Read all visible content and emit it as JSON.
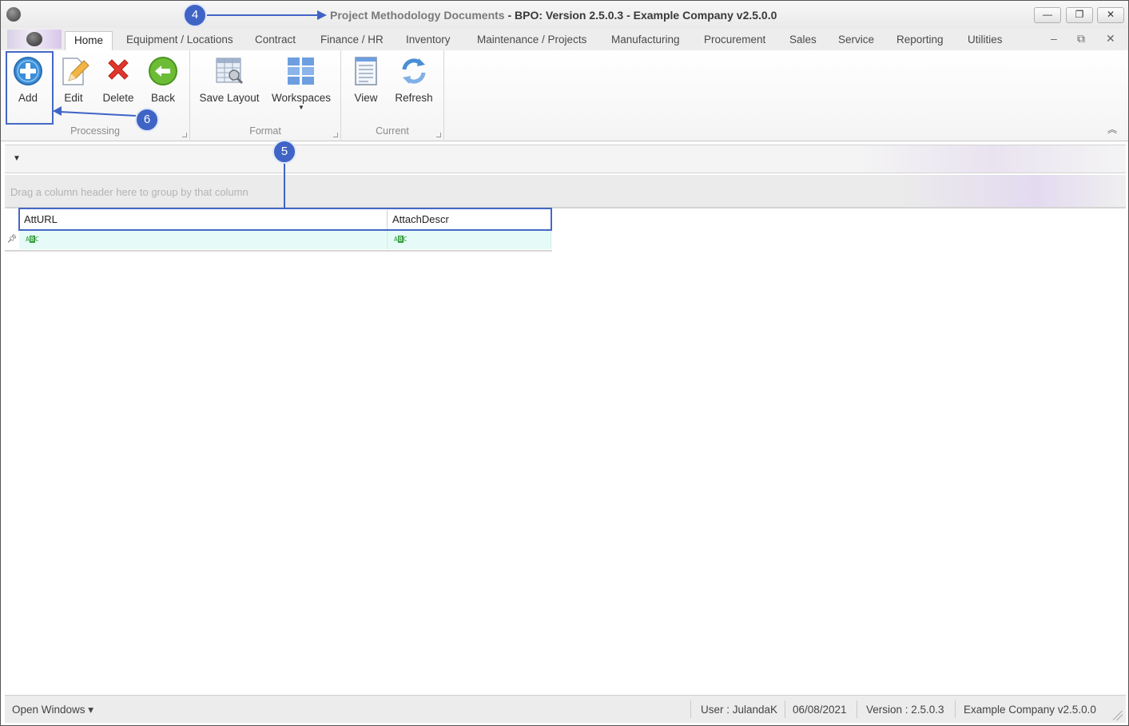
{
  "window": {
    "title_prefix": "Project Methodology Documents",
    "title_rest": " - BPO: Version 2.5.0.3 - Example Company v2.5.0.0",
    "minimize": "—",
    "maximize": "❐",
    "close": "✕"
  },
  "tabs": [
    "Home",
    "Equipment / Locations",
    "Contract",
    "Finance / HR",
    "Inventory",
    "Maintenance / Projects",
    "Manufacturing",
    "Procurement",
    "Sales",
    "Service",
    "Reporting",
    "Utilities"
  ],
  "mdi_controls": {
    "minimize": "–",
    "restore": "⧉",
    "close": "✕"
  },
  "ribbon": {
    "processing": {
      "label": "Processing",
      "add": "Add",
      "edit": "Edit",
      "delete": "Delete",
      "back": "Back"
    },
    "format": {
      "label": "Format",
      "save_layout": "Save Layout",
      "workspaces": "Workspaces"
    },
    "current": {
      "label": "Current",
      "view": "View",
      "refresh": "Refresh"
    }
  },
  "annotations": {
    "badge4": "4",
    "badge5": "5",
    "badge6": "6"
  },
  "grid": {
    "group_hint": "Drag a column header here to group by that column",
    "columns": [
      "AttURL",
      "AttachDescr"
    ]
  },
  "statusbar": {
    "open_windows": "Open Windows ▾",
    "user": "User : JulandaK",
    "date": "06/08/2021",
    "version": "Version : 2.5.0.3",
    "company": "Example Company v2.5.0.0"
  },
  "colors": {
    "accent": "#3f64c6",
    "new_row": "#e6fbf8",
    "add_icon": "#3b8fd8",
    "delete_icon": "#e0362c",
    "back_icon": "#6cbd35"
  }
}
